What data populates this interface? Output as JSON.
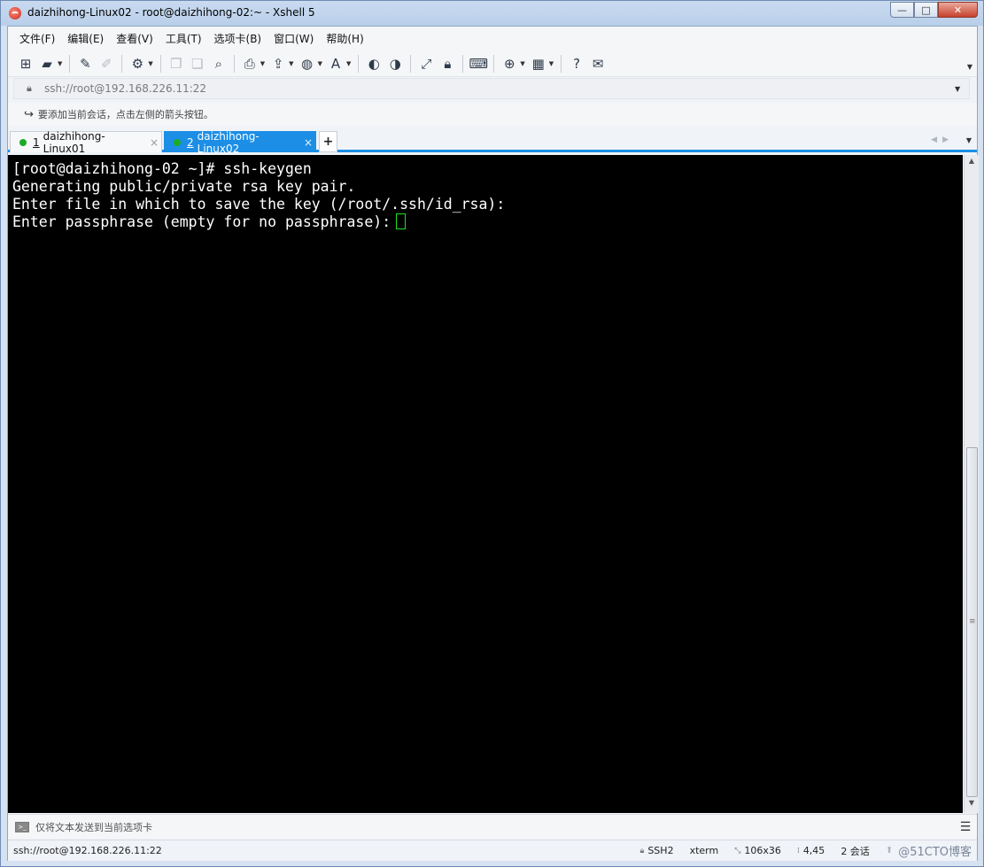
{
  "window": {
    "title": "daizhihong-Linux02 - root@daizhihong-02:~ - Xshell 5",
    "controls": {
      "minimize": "—",
      "maximize": "□",
      "close": "✕"
    }
  },
  "menu": [
    "文件(F)",
    "编辑(E)",
    "查看(V)",
    "工具(T)",
    "选项卡(B)",
    "窗口(W)",
    "帮助(H)"
  ],
  "address": {
    "value": "ssh://root@192.168.226.11:22"
  },
  "hint": {
    "text": "要添加当前会话，点击左侧的箭头按钮。"
  },
  "tabs": [
    {
      "num": "1",
      "label": "daizhihong-Linux01",
      "active": false
    },
    {
      "num": "2",
      "label": "daizhihong-Linux02",
      "active": true
    }
  ],
  "tab_add": "+",
  "terminal": {
    "lines": [
      "[root@daizhihong-02 ~]# ssh-keygen",
      "Generating public/private rsa key pair.",
      "Enter file in which to save the key (/root/.ssh/id_rsa):",
      "Enter passphrase (empty for no passphrase):"
    ]
  },
  "compose": {
    "placeholder": "仅将文本发送到当前选项卡"
  },
  "status": {
    "connection": "ssh://root@192.168.226.11:22",
    "protocol": "SSH2",
    "terminal_type": "xterm",
    "size": "106x36",
    "cursor_pos": "4,45",
    "sessions": "2 会话",
    "watermark": "@51CTO博客"
  },
  "colors": {
    "accent": "#1c8ee6",
    "terminal_bg": "#000000",
    "terminal_fg": "#ffffff",
    "cursor": "#20e020",
    "tab_dot": "#1aac24"
  }
}
